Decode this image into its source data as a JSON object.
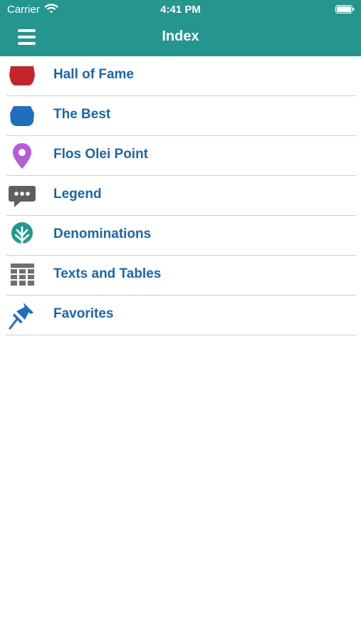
{
  "status_bar": {
    "carrier": "Carrier",
    "time": "4:41 PM"
  },
  "header": {
    "title": "Index",
    "menu_icon": "hamburger-menu-icon"
  },
  "colors": {
    "header_bg": "#24968e",
    "label": "#1a66b0",
    "divider": "#cfcfcf"
  },
  "menu": {
    "items": [
      {
        "label": "Hall of Fame",
        "icon": "red-bowl-icon",
        "icon_color": "#c0262b"
      },
      {
        "label": "The Best",
        "icon": "blue-bowl-icon",
        "icon_color": "#1f6fbf"
      },
      {
        "label": "Flos Olei Point",
        "icon": "map-pin-icon",
        "icon_color": "#b75cd8"
      },
      {
        "label": "Legend",
        "icon": "speech-bubble-icon",
        "icon_color": "#5f5f5f"
      },
      {
        "label": "Denominations",
        "icon": "tree-icon",
        "icon_color": "#1f9a8e"
      },
      {
        "label": "Texts and Tables",
        "icon": "table-grid-icon",
        "icon_color": "#6f6f6f"
      },
      {
        "label": "Favorites",
        "icon": "pushpin-icon",
        "icon_color": "#1f6fbf"
      }
    ]
  }
}
